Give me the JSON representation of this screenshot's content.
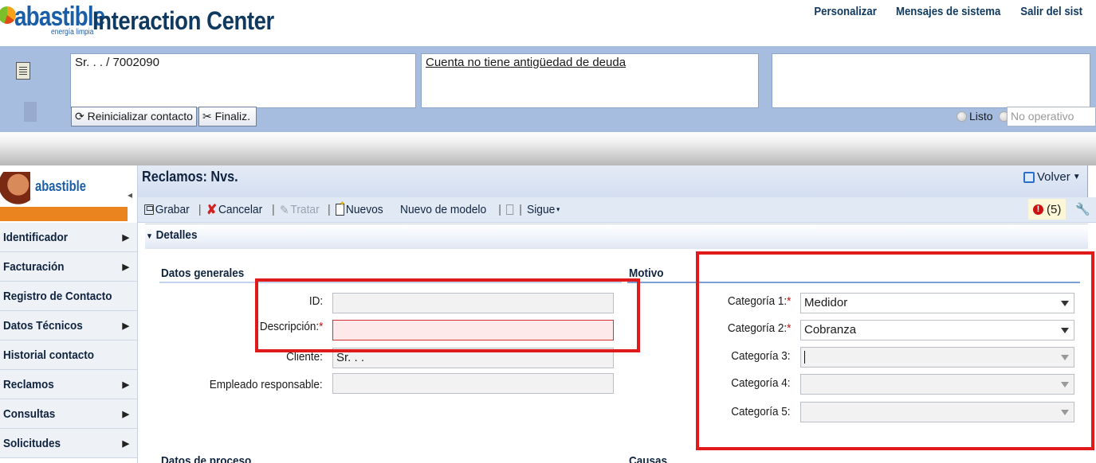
{
  "brand": {
    "logo_text": "abastible",
    "tagline": "energía limpia",
    "app_title": "Interaction Center"
  },
  "top_links": [
    "Personalizar",
    "Mensajes de sistema",
    "Salir del sist"
  ],
  "contact": {
    "customer": "Sr. . . / 7002090",
    "message": "Cuenta no tiene antigüedad de deuda",
    "third": ""
  },
  "contact_buttons": {
    "reset": "Reinicializar contacto",
    "end": "Finaliz."
  },
  "status": {
    "ready": "Listo",
    "not_operative": "No operativo"
  },
  "nav": {
    "logo_text": "abastible",
    "items": [
      {
        "label": "Identificador",
        "has_submenu": true
      },
      {
        "label": "Facturación",
        "has_submenu": true
      },
      {
        "label": "Registro de Contacto",
        "has_submenu": false
      },
      {
        "label": "Datos Técnicos",
        "has_submenu": true
      },
      {
        "label": "Historial contacto",
        "has_submenu": false
      },
      {
        "label": "Reclamos",
        "has_submenu": true
      },
      {
        "label": "Consultas",
        "has_submenu": true
      },
      {
        "label": "Solicitudes",
        "has_submenu": true
      }
    ]
  },
  "page": {
    "title": "Reclamos: Nvs.",
    "back_label": "Volver"
  },
  "toolbar": {
    "save": "Grabar",
    "cancel": "Cancelar",
    "process": "Tratar",
    "new": "Nuevos",
    "new_from_template": "Nuevo de modelo",
    "next": "Sigue"
  },
  "alerts": {
    "count": "(5)"
  },
  "details": {
    "title": "Detalles",
    "general_title": "Datos generales",
    "motivo_title": "Motivo",
    "proceso_title": "Datos de proceso",
    "causas_title": "Causas",
    "fields": {
      "id_label": "ID:",
      "id_value": "",
      "desc_label": "Descripción:",
      "desc_value": "",
      "client_label": "Cliente:",
      "client_value": "Sr. . .",
      "resp_label": "Empleado responsable:",
      "resp_value": ""
    },
    "categories": [
      {
        "label": "Categoría 1:",
        "required": true,
        "value": "Medidor",
        "disabled": false
      },
      {
        "label": "Categoría 2:",
        "required": true,
        "value": "Cobranza",
        "disabled": false
      },
      {
        "label": "Categoría 3:",
        "required": false,
        "value": "",
        "disabled": true
      },
      {
        "label": "Categoría 4:",
        "required": false,
        "value": "",
        "disabled": true
      },
      {
        "label": "Categoría 5:",
        "required": false,
        "value": "",
        "disabled": true
      }
    ]
  },
  "colors": {
    "header_blue": "#a7bde0",
    "title_navy": "#10395f",
    "annotation_red": "#e01a1a",
    "error_field_bg": "#fde8ea"
  }
}
